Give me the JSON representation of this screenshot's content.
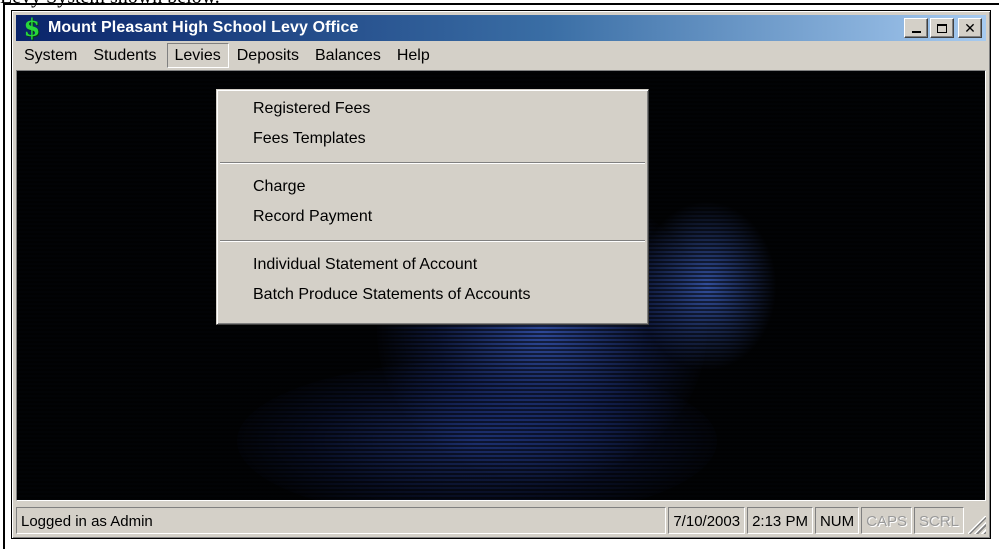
{
  "document_fragment": "Levy System shown below.",
  "window": {
    "title": "Mount Pleasant High School Levy Office",
    "icon": "dollar-sign-icon",
    "controls": {
      "minimize": "minimize-icon",
      "maximize": "maximize-icon",
      "close": "close-icon",
      "close_glyph": "✕"
    }
  },
  "menubar": {
    "items": [
      {
        "label": "System"
      },
      {
        "label": "Students"
      },
      {
        "label": "Levies",
        "open": true
      },
      {
        "label": "Deposits"
      },
      {
        "label": "Balances"
      },
      {
        "label": "Help"
      }
    ]
  },
  "levies_menu": {
    "groups": [
      [
        "Registered Fees",
        "Fees Templates"
      ],
      [
        "Charge",
        "Record Payment"
      ],
      [
        "Individual Statement of Account",
        "Batch Produce Statements of Accounts"
      ]
    ]
  },
  "statusbar": {
    "message": "Logged in as Admin",
    "date": "7/10/2003",
    "time": "2:13 PM",
    "num": "NUM",
    "caps": "CAPS",
    "scrl": "SCRL"
  },
  "colors": {
    "title_gradient_start": "#0a246a",
    "title_gradient_end": "#a6caf0",
    "window_face": "#d4d0c8",
    "client_background": "#020305",
    "icon_green": "#27d63c"
  }
}
